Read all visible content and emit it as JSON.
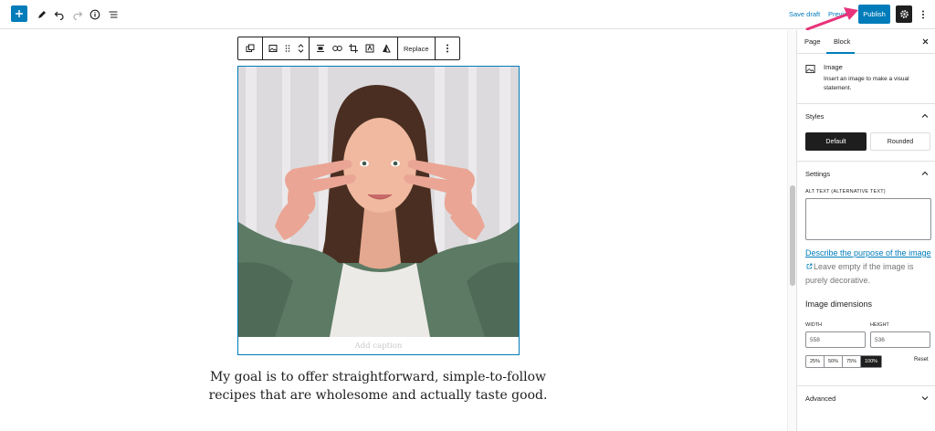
{
  "topbar": {
    "save_draft": "Save draft",
    "preview": "Preview",
    "publish": "Publish"
  },
  "block_toolbar": {
    "replace": "Replace"
  },
  "editor": {
    "caption_placeholder": "Add caption",
    "paragraph": "My goal is to offer straightforward, simple-to-follow recipes that are wholesome and actually taste good."
  },
  "sidebar": {
    "tabs": {
      "page": "Page",
      "block": "Block"
    },
    "block_card": {
      "title": "Image",
      "description": "Insert an image to make a visual statement."
    },
    "styles": {
      "title": "Styles",
      "default": "Default",
      "rounded": "Rounded"
    },
    "settings": {
      "title": "Settings",
      "alt_label": "ALT TEXT (ALTERNATIVE TEXT)",
      "alt_value": "",
      "help_link": "Describe the purpose of the image",
      "help_text": "Leave empty if the image is purely decorative.",
      "dimensions_title": "Image dimensions",
      "width_label": "WIDTH",
      "width_value": "558",
      "height_label": "HEIGHT",
      "height_value": "536",
      "percents": [
        "25%",
        "50%",
        "75%",
        "100%"
      ],
      "reset": "Reset"
    },
    "advanced": {
      "title": "Advanced"
    }
  },
  "colors": {
    "accent": "#007cba",
    "dark": "#1e1e1e",
    "annotation_arrow": "#e8337a"
  }
}
